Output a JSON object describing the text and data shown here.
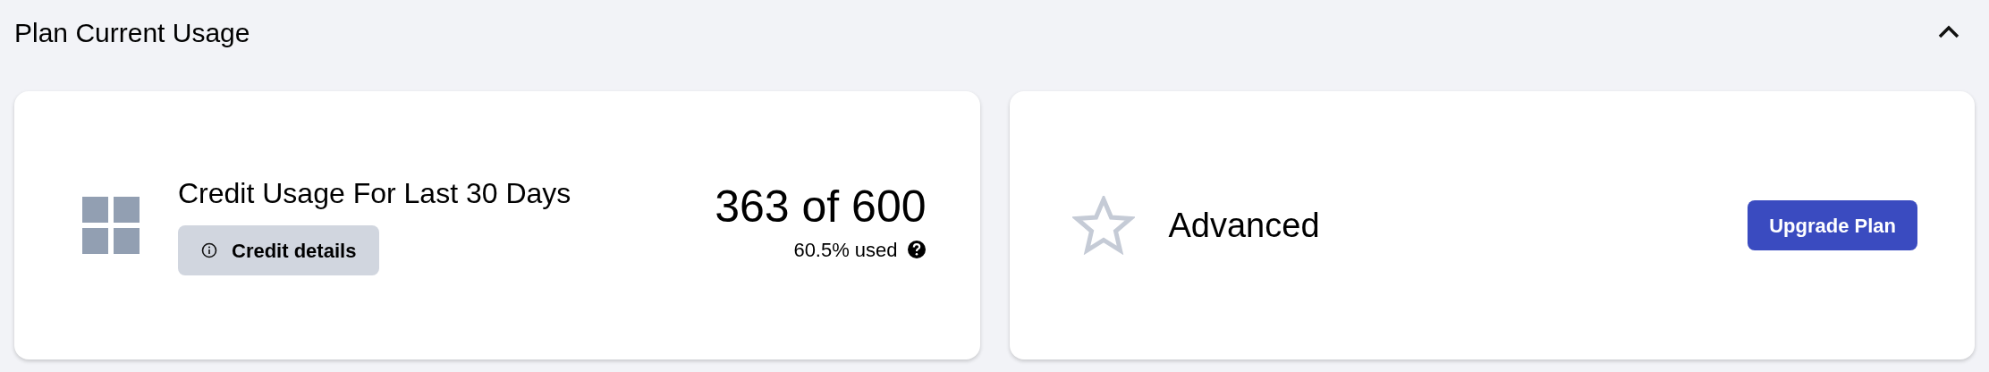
{
  "section": {
    "title": "Plan Current Usage",
    "expanded": true
  },
  "usage_card": {
    "title": "Credit Usage For Last 30 Days",
    "details_button": "Credit details",
    "total": "363 of 600",
    "percent": "60.5%",
    "used_label": "used"
  },
  "plan_card": {
    "plan": "Advanced",
    "upgrade_button": "Upgrade Plan"
  }
}
